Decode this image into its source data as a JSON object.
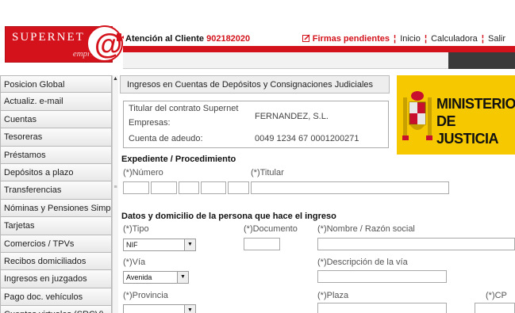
{
  "header": {
    "logo_top": "SUPERNET",
    "logo_sub": "empresas",
    "logo_at": "@",
    "atencion_label": "Atención al Cliente",
    "atencion_number": "902182020",
    "links": {
      "pendientes": "Firmas pendientes",
      "inicio": "Inicio",
      "calculadora": "Calculadora",
      "salir": "Salir"
    },
    "colors": {
      "brand_red": "#d3121b"
    }
  },
  "sidebar": {
    "items": [
      "Posicion Global",
      "Actualiz. e-mail",
      "Cuentas",
      "Tesoreras",
      "Préstamos",
      "Depósitos a plazo",
      "Transferencias",
      "Nóminas y Pensiones Simples",
      "Tarjetas",
      "Comercios / TPVs",
      "Recibos domiciliados",
      "Ingresos en juzgados",
      "Pago doc. vehículos",
      "Cuentas virtuales (SRCV)"
    ]
  },
  "main": {
    "title": "Ingresos en Cuentas de Depósitos y Consignaciones Judiciales",
    "info": {
      "titular_label": "Titular del contrato Supernet",
      "empresas_label": "Empresas:",
      "empresas_value": "FERNANDEZ, S.L.",
      "cuenta_label": "Cuenta de adeudo:",
      "cuenta_value": "0049 1234 67 0001200271"
    },
    "ministerio": {
      "line1": "MINISTERIO",
      "line2": "DE JUSTICIA",
      "color": "#f6c800"
    },
    "expediente": {
      "title": "Expediente / Procedimiento",
      "numero_label": "(*)Número",
      "titular_label": "(*)Titular"
    },
    "datos": {
      "title": "Datos y domicilio de la persona que hace el ingreso",
      "tipo_label": "(*)Tipo",
      "tipo_value": "NIF",
      "documento_label": "(*)Documento",
      "nombre_label": "(*)Nombre / Razón social",
      "via_label": "(*)Vía",
      "via_value": "Avenida",
      "descripcion_label": "(*)Descripción de la vía",
      "provincia_label": "(*)Provincia",
      "provincia_value": "",
      "plaza_label": "(*)Plaza",
      "cp_label": "(*)CP"
    }
  }
}
